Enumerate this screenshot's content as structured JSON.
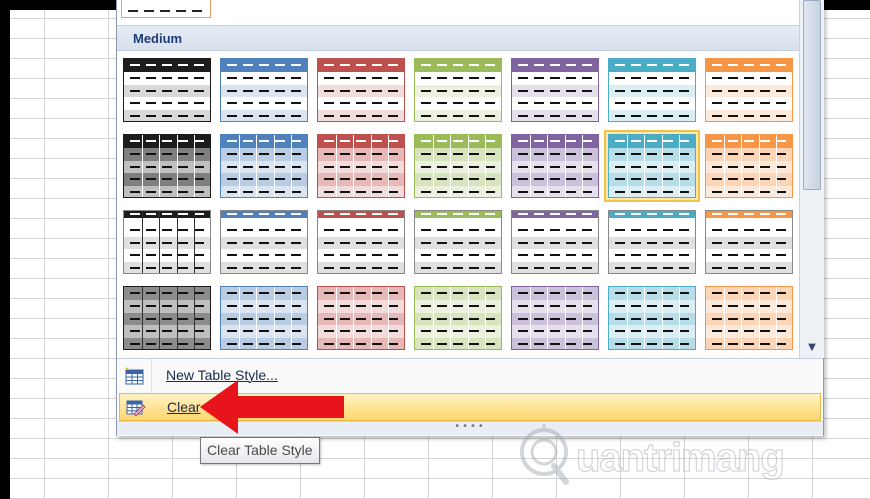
{
  "gallery": {
    "section_label": "Medium",
    "selected_index": 12,
    "colors": {
      "accent_black": "#1c1c1c",
      "accent_blue": "#4f81bd",
      "accent_red": "#c0504d",
      "accent_green": "#9bbb59",
      "accent_purple": "#8064a2",
      "accent_aqua": "#4bacc6",
      "accent_orange": "#f79646"
    }
  },
  "menu": {
    "new_style_label": "New Table Style...",
    "clear_label": "Clear",
    "new_style_icon": "new-table-style-icon",
    "clear_icon": "clear-table-style-icon"
  },
  "tooltip": {
    "text": "Clear Table Style"
  },
  "scrollbar": {
    "down_arrow_icon": "scroll-down-arrow-icon"
  },
  "annotation": {
    "arrow_color": "#e8141b"
  },
  "watermark": {
    "text": "uantrimang"
  }
}
